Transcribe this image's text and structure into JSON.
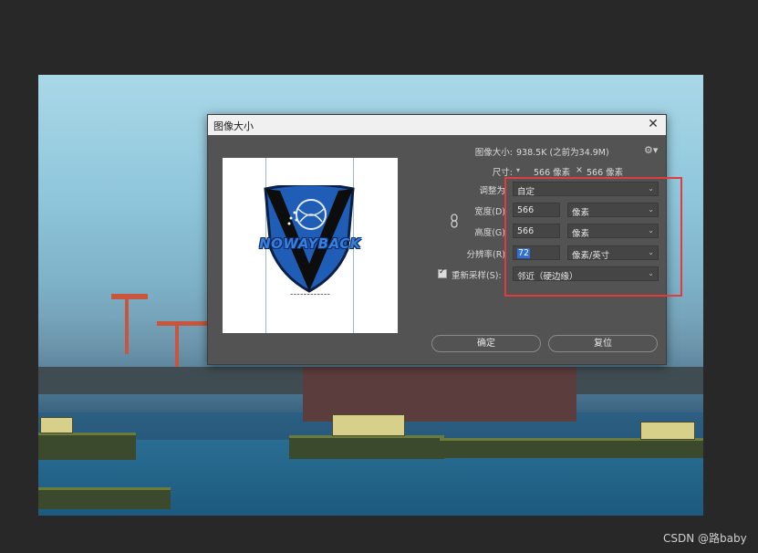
{
  "dialog": {
    "title": "图像大小",
    "image_size_label": "图像大小:",
    "image_size_value": "938.5K (之前为34.9M)",
    "dimensions_label": "尺寸:",
    "dimensions_width": "566 像素",
    "dimensions_sep": "×",
    "dimensions_height": "566 像素",
    "fit_to_label": "调整为",
    "fit_to_value": "自定",
    "width_label": "宽度(D)",
    "width_value": "566",
    "width_unit": "像素",
    "height_label": "高度(G)",
    "height_value": "566",
    "height_unit": "像素",
    "resolution_label": "分辨率(R)",
    "resolution_value": "72",
    "resolution_unit": "像素/英寸",
    "resample_label": "重新采样(S):",
    "resample_value": "邻近（硬边缘）",
    "ok_button": "确定",
    "reset_button": "复位"
  },
  "preview": {
    "logo_text": "NOWAYBACK"
  },
  "watermark": "CSDN @路baby",
  "colors": {
    "highlight": "#e33b3b",
    "dialog_bg": "#535353",
    "selection": "#2f6fd6",
    "logo_blue": "#1f5db6"
  }
}
